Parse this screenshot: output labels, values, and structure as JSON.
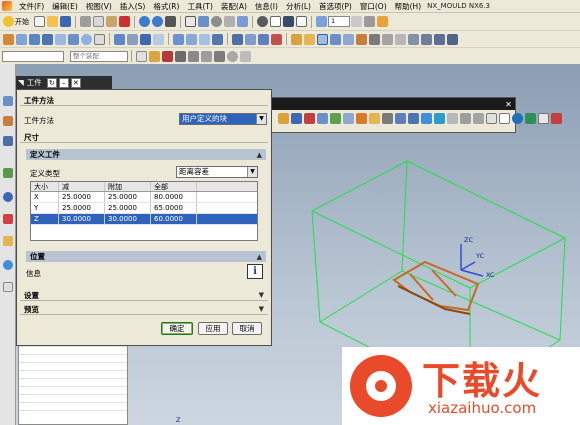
{
  "window": {
    "app_title": "NX_MOULD NX6.3"
  },
  "menubar": {
    "items": [
      "文件(F)",
      "编辑(E)",
      "视图(V)",
      "插入(S)",
      "格式(R)",
      "工具(T)",
      "装配(A)",
      "信息(I)",
      "分析(L)",
      "首选项(P)",
      "窗口(O)",
      "帮助(H)"
    ]
  },
  "toolbar": {
    "start_label": "开始",
    "filter_dropdown": "整个装配",
    "layer_value": "1"
  },
  "dialog_header": {
    "tab_label": "工件"
  },
  "dialog": {
    "section_method": {
      "title": "工件方法",
      "field_label": "工件方法",
      "field_value": "用户定义的块"
    },
    "section_size": {
      "title": "尺寸",
      "subsection_define": {
        "title": "定义工件",
        "type_label": "定义类型",
        "type_value": "距离容差",
        "table": {
          "headers": [
            "大小",
            "减",
            "附加",
            "全部"
          ],
          "rows": [
            [
              "X",
              "25.0000",
              "25.0000",
              "80.0000"
            ],
            [
              "Y",
              "25.0000",
              "25.0000",
              "65.0000"
            ],
            [
              "Z",
              "30.0000",
              "30.0000",
              "60.0000"
            ]
          ],
          "selected_row": 2
        }
      },
      "subsection_position": {
        "title": "位置"
      },
      "info_label": "信息",
      "info_button": "i"
    },
    "section_settings": {
      "title": "设置"
    },
    "section_preview": {
      "title": "预览"
    },
    "buttons": {
      "ok": "确定",
      "apply": "应用",
      "cancel": "取消"
    }
  },
  "viewport": {
    "axis_labels": {
      "zc": "ZC",
      "yc": "YC",
      "xc": "XC",
      "z": "Z"
    },
    "wireframe_color": "#22e04a",
    "part_color": "#d4782a"
  },
  "watermark": {
    "title": "下载火",
    "url": "xiazaihuo.com",
    "color": "#e84a2a"
  },
  "icons": [
    "start-icon",
    "new-icon",
    "open-icon",
    "save-icon",
    "cut-icon",
    "copy-icon",
    "paste-icon",
    "undo-icon",
    "redo-icon",
    "fit-icon",
    "shaded-icon",
    "layer-icon",
    "info-icon"
  ]
}
